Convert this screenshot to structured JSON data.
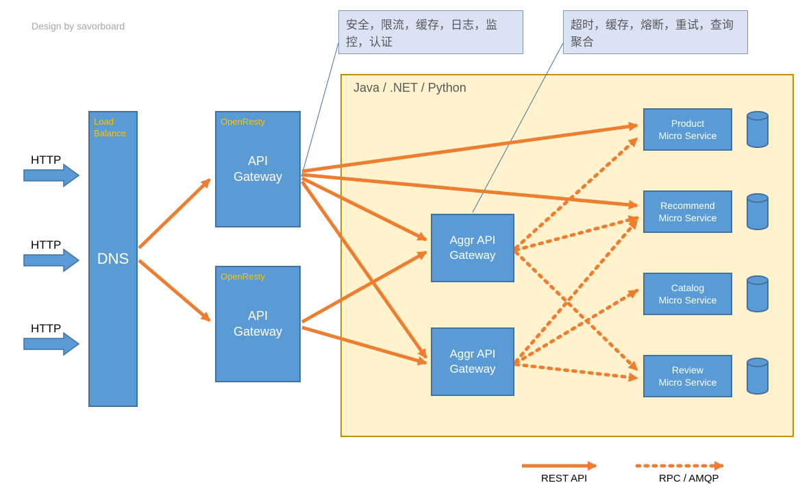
{
  "credit": "Design by savorboard",
  "http_labels": [
    "HTTP",
    "HTTP",
    "HTTP"
  ],
  "load_balance": {
    "small": "Load Balance",
    "main": "DNS"
  },
  "gateways": [
    {
      "small": "OpenResty",
      "main": "API Gateway"
    },
    {
      "small": "OpenResty",
      "main": "API Gateway"
    }
  ],
  "container_label": "Java / .NET / Python",
  "aggr": [
    "Aggr API Gateway",
    "Aggr API Gateway"
  ],
  "services": [
    "Product Micro Service",
    "Recommend Micro Service",
    "Catalog Micro Service",
    "Review Micro Service"
  ],
  "notes": {
    "left": "安全，限流，缓存，日志，监控，认证",
    "right": "超时，缓存，熔断，重试，查询聚合"
  },
  "legend": {
    "rest": "REST API",
    "rpc": "RPC / AMQP"
  }
}
